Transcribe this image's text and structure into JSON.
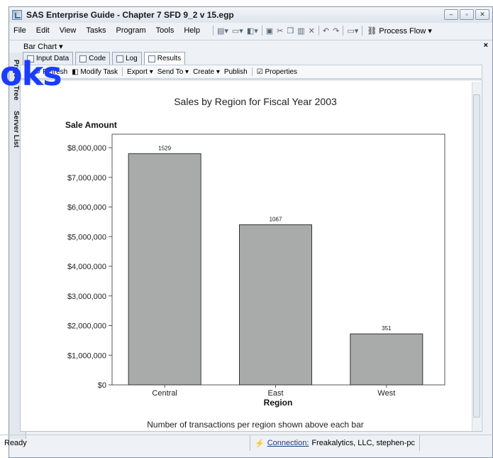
{
  "window": {
    "title": "SAS Enterprise Guide - Chapter 7 SFD 9_2 v 15.egp"
  },
  "menu": [
    "File",
    "Edit",
    "View",
    "Tasks",
    "Program",
    "Tools",
    "Help"
  ],
  "process_flow": "Process Flow",
  "doc_tab": "Bar Chart",
  "side_labels": [
    "Project Tree",
    "Server List"
  ],
  "tabs": [
    "Input Data",
    "Code",
    "Log",
    "Results"
  ],
  "result_toolbar": [
    "Refresh",
    "Modify Task",
    "Export",
    "Send To",
    "Create",
    "Publish",
    "Properties"
  ],
  "status": {
    "ready": "Ready",
    "connection_label": "Connection:",
    "connection_value": "Freakalytics, LLC, stephen-pc"
  },
  "watermark": {
    "text": "oks"
  },
  "chart_data": {
    "type": "bar",
    "title": "Sales by Region for Fiscal Year 2003",
    "ylabel": "Sale Amount",
    "xlabel": "Region",
    "footnote": "Number of transactions per region shown above each bar",
    "categories": [
      "Central",
      "East",
      "West"
    ],
    "values": [
      7800000,
      5400000,
      1720000
    ],
    "bar_labels": [
      "1529",
      "1067",
      "351"
    ],
    "ylim": [
      0,
      8000000
    ],
    "yticks": [
      0,
      1000000,
      2000000,
      3000000,
      4000000,
      5000000,
      6000000,
      7000000,
      8000000
    ],
    "ytick_labels": [
      "$0",
      "$1,000,000",
      "$2,000,000",
      "$3,000,000",
      "$4,000,000",
      "$5,000,000",
      "$6,000,000",
      "$7,000,000",
      "$8,000,000"
    ],
    "bar_color": "#a9aaaa",
    "grid": false
  }
}
